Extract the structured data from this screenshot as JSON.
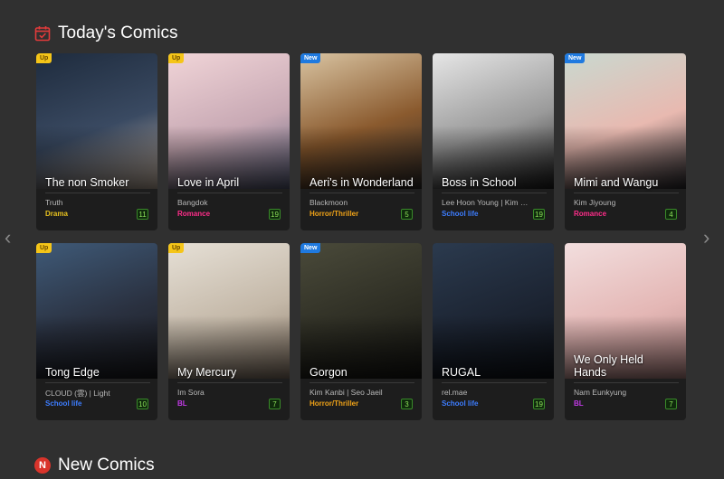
{
  "sections": {
    "today_title": "Today's Comics",
    "new_title": "New Comics",
    "new_icon_letter": "N"
  },
  "colors": {
    "background": "#303030",
    "up_badge": "#f5c518",
    "new_badge": "#1f7ae0",
    "genre_drama": "#e8c21e",
    "genre_romance": "#ff2d8a",
    "genre_horror": "#f0a318",
    "genre_school": "#3d7dff",
    "genre_bl": "#c23ae6",
    "count_green": "#8de05a"
  },
  "icons": {
    "today": "calendar-check-icon",
    "new": "new-n-icon",
    "prev": "chevron-left-icon",
    "next": "chevron-right-icon"
  },
  "comics": [
    {
      "badge": "Up",
      "title": "The non Smoker",
      "author": "Truth",
      "genre": "Drama",
      "genre_color": "#e8c21e",
      "count": "11",
      "art": [
        "#1e2b3d",
        "#3a4a62",
        "#c9b7a6"
      ]
    },
    {
      "badge": "Up",
      "title": "Love in April",
      "author": "Bangdok",
      "genre": "Romance",
      "genre_color": "#ff2d8a",
      "count": "19",
      "art": [
        "#f1d5d8",
        "#c8a9b4",
        "#5a5f7a"
      ]
    },
    {
      "badge": "New",
      "title": "Aeri's in Wonderland",
      "author": "Blackmoon",
      "genre": "Horror/Thriller",
      "genre_color": "#f0a318",
      "count": "5",
      "art": [
        "#d9c4a2",
        "#8a5a2e",
        "#2e2a28"
      ]
    },
    {
      "badge": "",
      "title": "Boss in School",
      "author": "Lee Hoon Young | Kim Ui...",
      "genre": "School life",
      "genre_color": "#3d7dff",
      "count": "19",
      "art": [
        "#e6e6e6",
        "#9a9a9a",
        "#1c1c1c"
      ]
    },
    {
      "badge": "New",
      "title": "Mimi and Wangu",
      "author": "Kim Jiyoung",
      "genre": "Romance",
      "genre_color": "#ff2d8a",
      "count": "4",
      "art": [
        "#c9d9d0",
        "#e8b9b0",
        "#2a2a2e"
      ]
    },
    {
      "badge": "Up",
      "title": "Tong Edge",
      "author": "CLOUD (雲) | Light",
      "genre": "School life",
      "genre_color": "#3d7dff",
      "count": "10",
      "art": [
        "#3f5a78",
        "#2a3140",
        "#1a1a1e"
      ]
    },
    {
      "badge": "Up",
      "title": "My Mercury",
      "author": "Im Sora",
      "genre": "BL",
      "genre_color": "#c23ae6",
      "count": "7",
      "art": [
        "#e6e0d6",
        "#c4b8a8",
        "#8a7a6a"
      ]
    },
    {
      "badge": "New",
      "title": "Gorgon",
      "author": "Kim Kanbi | Seo Jaeil",
      "genre": "Horror/Thriller",
      "genre_color": "#f0a318",
      "count": "3",
      "art": [
        "#4a4a3a",
        "#2e2e24",
        "#151512"
      ]
    },
    {
      "badge": "",
      "title": "RUGAL",
      "author": "rel.mae",
      "genre": "School life",
      "genre_color": "#3d7dff",
      "count": "19",
      "art": [
        "#2b3a4e",
        "#1c2432",
        "#0e1218"
      ]
    },
    {
      "badge": "",
      "title": "We Only Held Hands",
      "author": "Nam Eunkyung",
      "genre": "BL",
      "genre_color": "#c23ae6",
      "count": "7",
      "art": [
        "#f2dede",
        "#e4b7b5",
        "#b88a88"
      ]
    }
  ]
}
